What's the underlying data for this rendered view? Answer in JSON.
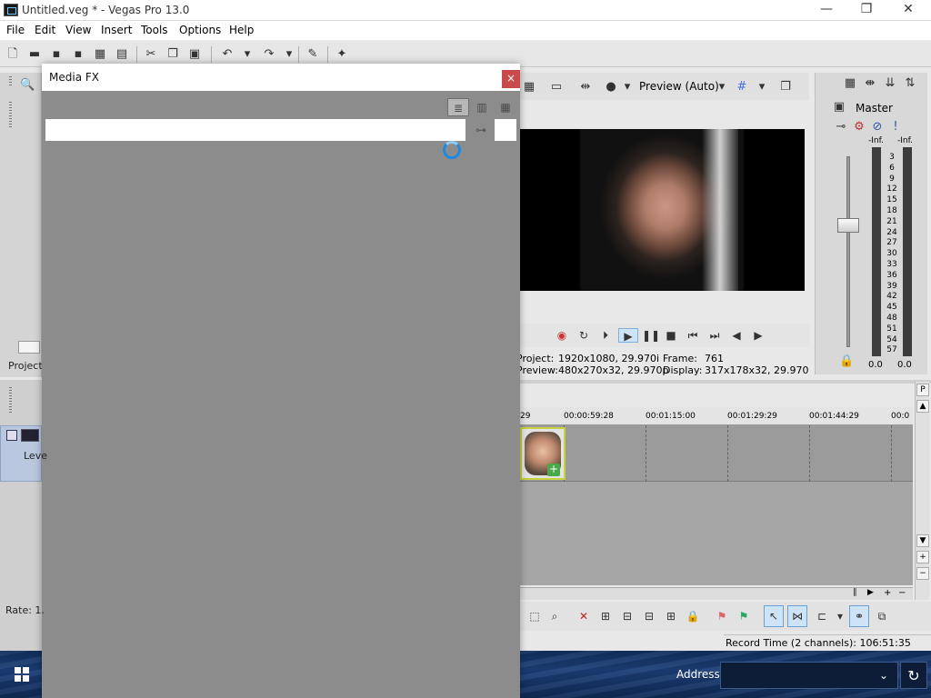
{
  "window": {
    "title": "Untitled.veg * - Vegas Pro 13.0",
    "minimize": "—",
    "maximize": "❐",
    "close": "✕"
  },
  "menu": [
    "File",
    "Edit",
    "View",
    "Insert",
    "Tools",
    "Options",
    "Help"
  ],
  "dialog": {
    "title": "Media FX",
    "close": "×",
    "search": {
      "value": "",
      "placeholder": ""
    },
    "view_modes": [
      "list-view",
      "grid-view-medium",
      "grid-view-small"
    ],
    "active_view": "list-view"
  },
  "preview": {
    "quality_label": "Preview (Auto)",
    "project_label": "Project:",
    "project_value": "1920x1080, 29.970i",
    "frame_label": "Frame:",
    "frame_value": "761",
    "preview_label": "Preview:",
    "preview_value": "480x270x32, 29.970p",
    "display_label": "Display:",
    "display_value": "317x178x32, 29.970"
  },
  "master": {
    "title": "Master",
    "inf_left": "-Inf.",
    "inf_right": "-Inf.",
    "scale": [
      "3",
      "6",
      "9",
      "12",
      "15",
      "18",
      "21",
      "24",
      "27",
      "30",
      "33",
      "36",
      "39",
      "42",
      "45",
      "48",
      "51",
      "54",
      "57"
    ],
    "level_left": "0.0",
    "level_right": "0.0"
  },
  "timeline": {
    "ruler": [
      "29",
      "00:00:59:28",
      "00:01:15:00",
      "00:01:29:29",
      "00:01:44:29",
      "00:0"
    ]
  },
  "left_labels": {
    "project": "Project",
    "track": "Leve",
    "rate": "Rate: 1."
  },
  "status": {
    "record_time": "Record Time (2 channels): 106:51:35"
  },
  "taskbar": {
    "address_label": "Address",
    "address_value": "",
    "apps": [
      "file-explorer",
      "chrome",
      "app-blue-check",
      "app-green",
      "vegas"
    ]
  },
  "colors": {
    "dialog_bg": "#8c8c8c",
    "accent": "#1e88e5",
    "clip_border": "#c8d23a",
    "close_red": "#c94a4a"
  }
}
